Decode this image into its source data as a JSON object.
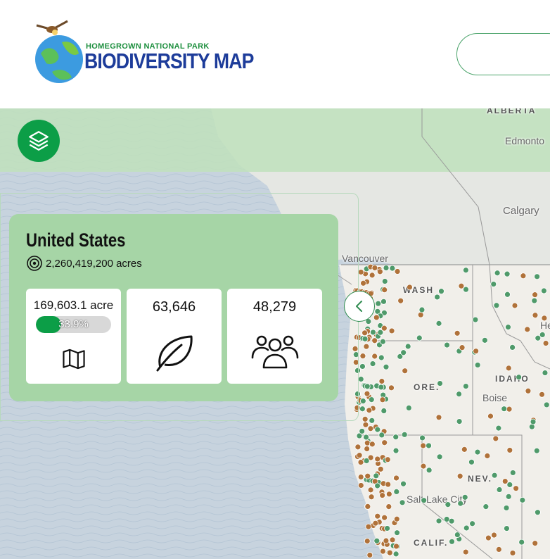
{
  "header": {
    "logo": {
      "top_text": "HOMEGROWN NATIONAL PARK",
      "main_text": "BIODIVERSITY MAP"
    }
  },
  "map": {
    "place_labels": {
      "alberta": "ALBERTA",
      "edmonton": "Edmonto",
      "calgary": "Calgary",
      "vancouver": "Vancouver",
      "wash": "WASH",
      "ore": "ORE.",
      "idaho": "IDAHO",
      "boise": "Boise",
      "nev": "NEV.",
      "salt_lake": "Salt Lake City",
      "calif": "CALIF.",
      "helena": "He"
    },
    "colors": {
      "green_dot": "#4f9a6a",
      "brown_dot": "#b0723a",
      "accent": "#0c9e47"
    }
  },
  "summary": {
    "country": "United States",
    "total_area": "2,260,419,200 acres",
    "stats": {
      "area": {
        "value": "169,603.1 acre",
        "percent_label": "33.9%",
        "percent": 33.9,
        "icon": "map-icon"
      },
      "plantings": {
        "value": "63,646",
        "icon": "leaf-icon"
      },
      "members": {
        "value": "48,279",
        "icon": "people-icon"
      }
    }
  },
  "icons": {
    "layers": "layers-icon",
    "collapse": "chevron-left-icon",
    "target": "target-icon"
  }
}
